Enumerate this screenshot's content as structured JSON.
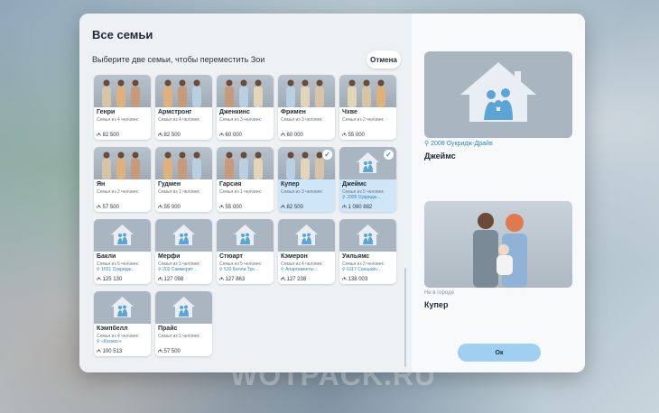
{
  "dialog": {
    "title": "Все семьи",
    "subtitle": "Выберите две семьи, чтобы переместить Зои",
    "cancel_label": "Отмена",
    "close_icon": "×"
  },
  "families": [
    {
      "name": "Генри",
      "size": "Семья из 4 человек",
      "address": "",
      "funds": "82 500",
      "photo": true,
      "selected": false
    },
    {
      "name": "Армстронг",
      "size": "Семья из 4 человек",
      "address": "",
      "funds": "82 500",
      "photo": true,
      "selected": false
    },
    {
      "name": "Дженкинс",
      "size": "Семья из 3 человек",
      "address": "",
      "funds": "60 000",
      "photo": true,
      "selected": false
    },
    {
      "name": "Фримен",
      "size": "Семья из 3 человек",
      "address": "",
      "funds": "60 000",
      "photo": true,
      "selected": false
    },
    {
      "name": "Чхве",
      "size": "Семья из 2 человек",
      "address": "",
      "funds": "55 000",
      "photo": true,
      "selected": false
    },
    {
      "name": "Ян",
      "size": "Семья из 2 человек",
      "address": "",
      "funds": "57 500",
      "photo": true,
      "selected": false
    },
    {
      "name": "Гудмен",
      "size": "Семья из 1 человек",
      "address": "",
      "funds": "55 000",
      "photo": true,
      "selected": false
    },
    {
      "name": "Гарсия",
      "size": "Семья из 1 человек",
      "address": "",
      "funds": "55 000",
      "photo": true,
      "selected": false
    },
    {
      "name": "Купер",
      "size": "Семья из 3 человек",
      "address": "",
      "funds": "82 500",
      "photo": true,
      "selected": true
    },
    {
      "name": "Джеймс",
      "size": "Семья из 5 человек",
      "address": "2008 Оукридж…",
      "funds": "1 080 882",
      "photo": false,
      "selected": true
    },
    {
      "name": "Бакли",
      "size": "Семья из 6 человек",
      "address": "1551 Оукридж…",
      "funds": "125 130",
      "photo": false,
      "selected": false
    },
    {
      "name": "Мерфи",
      "size": "Семья из 2 человек",
      "address": "203 Саммерит…",
      "funds": "127 098",
      "photo": false,
      "selected": false
    },
    {
      "name": "Стюарт",
      "size": "Семья из 5 человек",
      "address": "510 Белла Тре…",
      "funds": "127 863",
      "photo": false,
      "selected": false
    },
    {
      "name": "Кэмерон",
      "size": "Семья из 4 человек",
      "address": "Апартаменты…",
      "funds": "127 238",
      "photo": false,
      "selected": false
    },
    {
      "name": "Уильямс",
      "size": "Семья из 2 человек",
      "address": "6117 Саншайн…",
      "funds": "138 003",
      "photo": false,
      "selected": false
    },
    {
      "name": "Кэмпбелл",
      "size": "Семья из 4 человек",
      "address": "«Космос»",
      "funds": "100 513",
      "photo": false,
      "selected": false
    },
    {
      "name": "Прайс",
      "size": "Семья из 2 человек",
      "address": "",
      "funds": "57 500",
      "photo": false,
      "selected": false
    }
  ],
  "currency_symbol": "₼",
  "selection": {
    "first": {
      "address": "2008 Оукридж-Драйв",
      "name": "Джеймс"
    },
    "second": {
      "status": "Не в городе",
      "name": "Купер"
    }
  },
  "ok_label": "Ок",
  "watermark": "WOTPACK.RU",
  "colors": {
    "accent": "#3a8fd3",
    "selected_card": "#cfe6f8",
    "ok_button": "#9fd0f2",
    "placeholder": "#a9b6c1"
  }
}
